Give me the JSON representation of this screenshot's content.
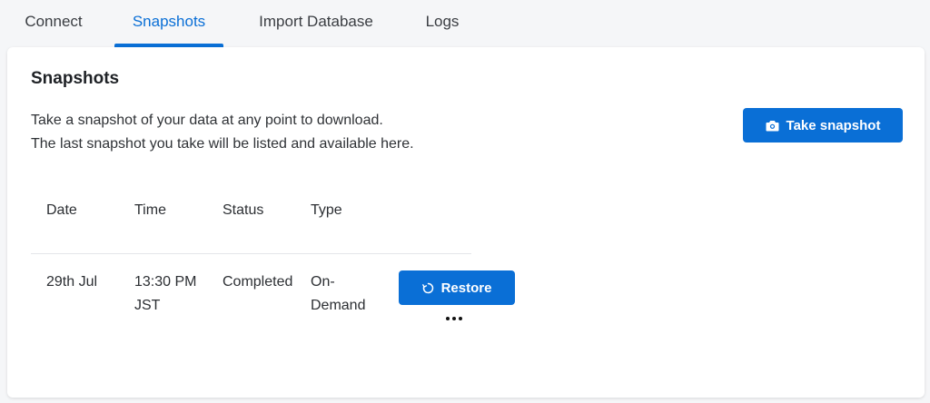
{
  "tabs": [
    {
      "label": "Connect"
    },
    {
      "label": "Snapshots"
    },
    {
      "label": "Import Database"
    },
    {
      "label": "Logs"
    }
  ],
  "active_tab": "Snapshots",
  "section": {
    "title": "Snapshots",
    "description_line1": "Take a snapshot of your data at any point to download.",
    "description_line2": "The last snapshot you take will be listed and available here.",
    "take_snapshot_label": "Take snapshot",
    "take_snapshot_icon": "camera-icon"
  },
  "table": {
    "columns": [
      "Date",
      "Time",
      "Status",
      "Type"
    ],
    "rows": [
      {
        "date": "29th Jul",
        "time": "13:30 PM JST",
        "status": "Completed",
        "type": "On-Demand",
        "restore_label": "Restore",
        "restore_icon": "restore-icon",
        "more_icon": "more-options-icon"
      }
    ]
  },
  "colors": {
    "accent": "#0a6fd6",
    "background": "#f5f6f8",
    "card": "#ffffff"
  }
}
